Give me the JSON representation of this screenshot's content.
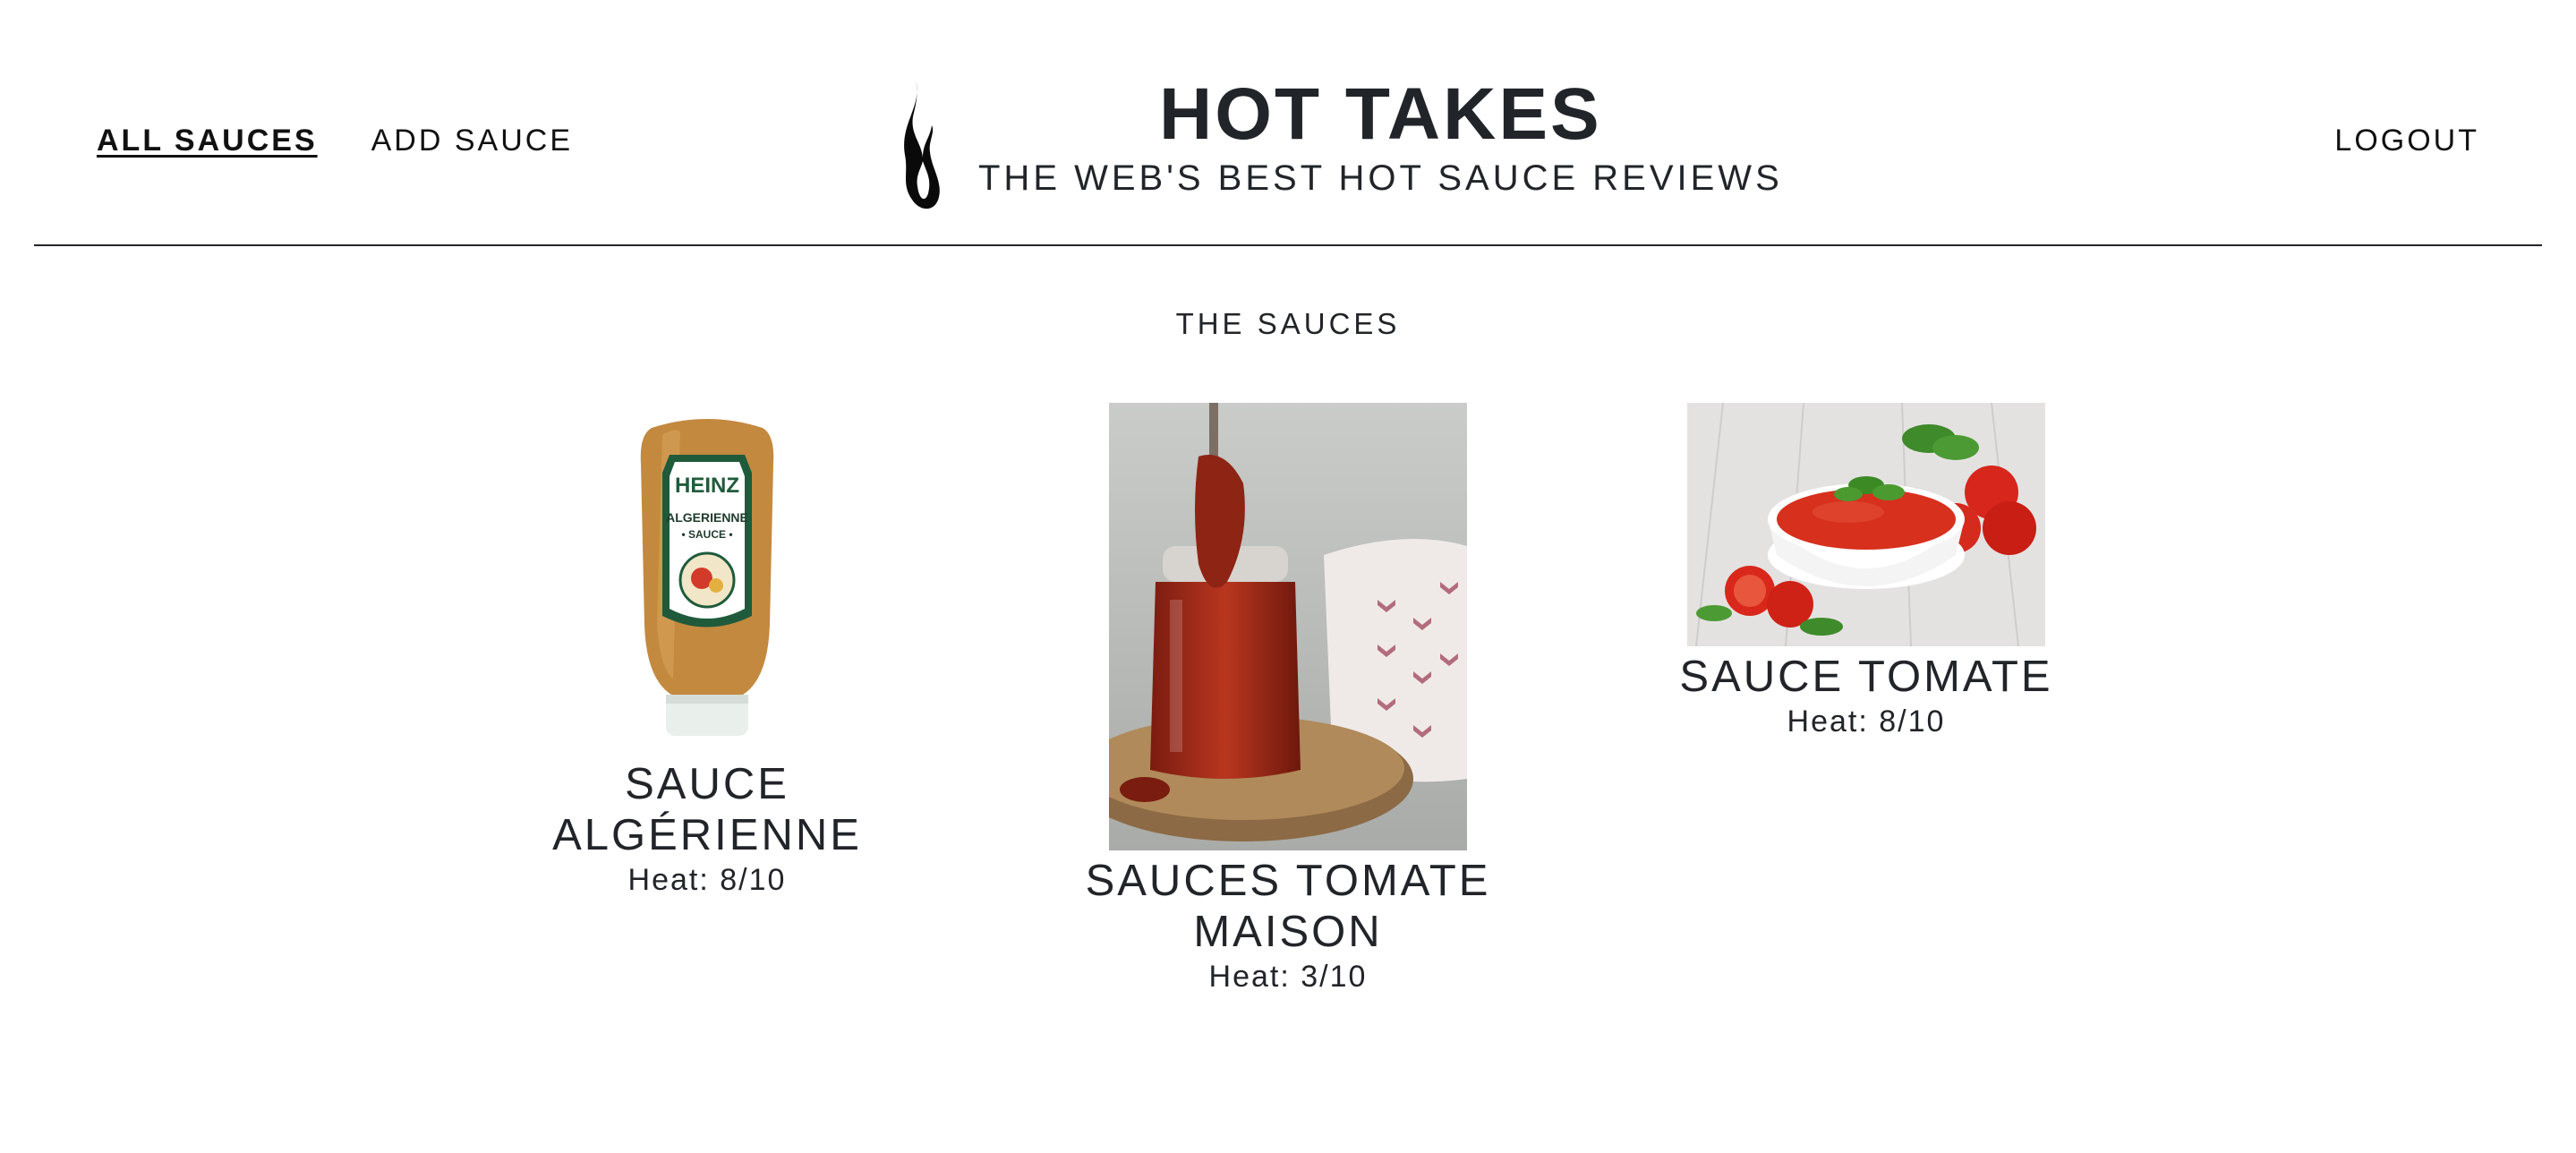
{
  "nav": {
    "all_sauces": "ALL SAUCES",
    "add_sauce": "ADD SAUCE",
    "logout": "LOGOUT"
  },
  "brand": {
    "title": "HOT TAKES",
    "subtitle": "THE WEB'S BEST HOT SAUCE REVIEWS",
    "logo_icon": "flame-icon"
  },
  "main": {
    "section_title": "THE SAUCES",
    "sauces": [
      {
        "name": "SAUCE ALGÉRIENNE",
        "heat": "Heat: 8/10",
        "image": "squeeze-bottle-photo"
      },
      {
        "name": "SAUCES TOMATE MAISON",
        "heat": "Heat: 3/10",
        "image": "tomato-sauce-jar-photo"
      },
      {
        "name": "SAUCE TOMATE",
        "heat": "Heat: 8/10",
        "image": "tomato-sauce-bowl-photo"
      }
    ]
  },
  "colors": {
    "text": "#212529",
    "background": "#ffffff",
    "divider": "#212529"
  }
}
